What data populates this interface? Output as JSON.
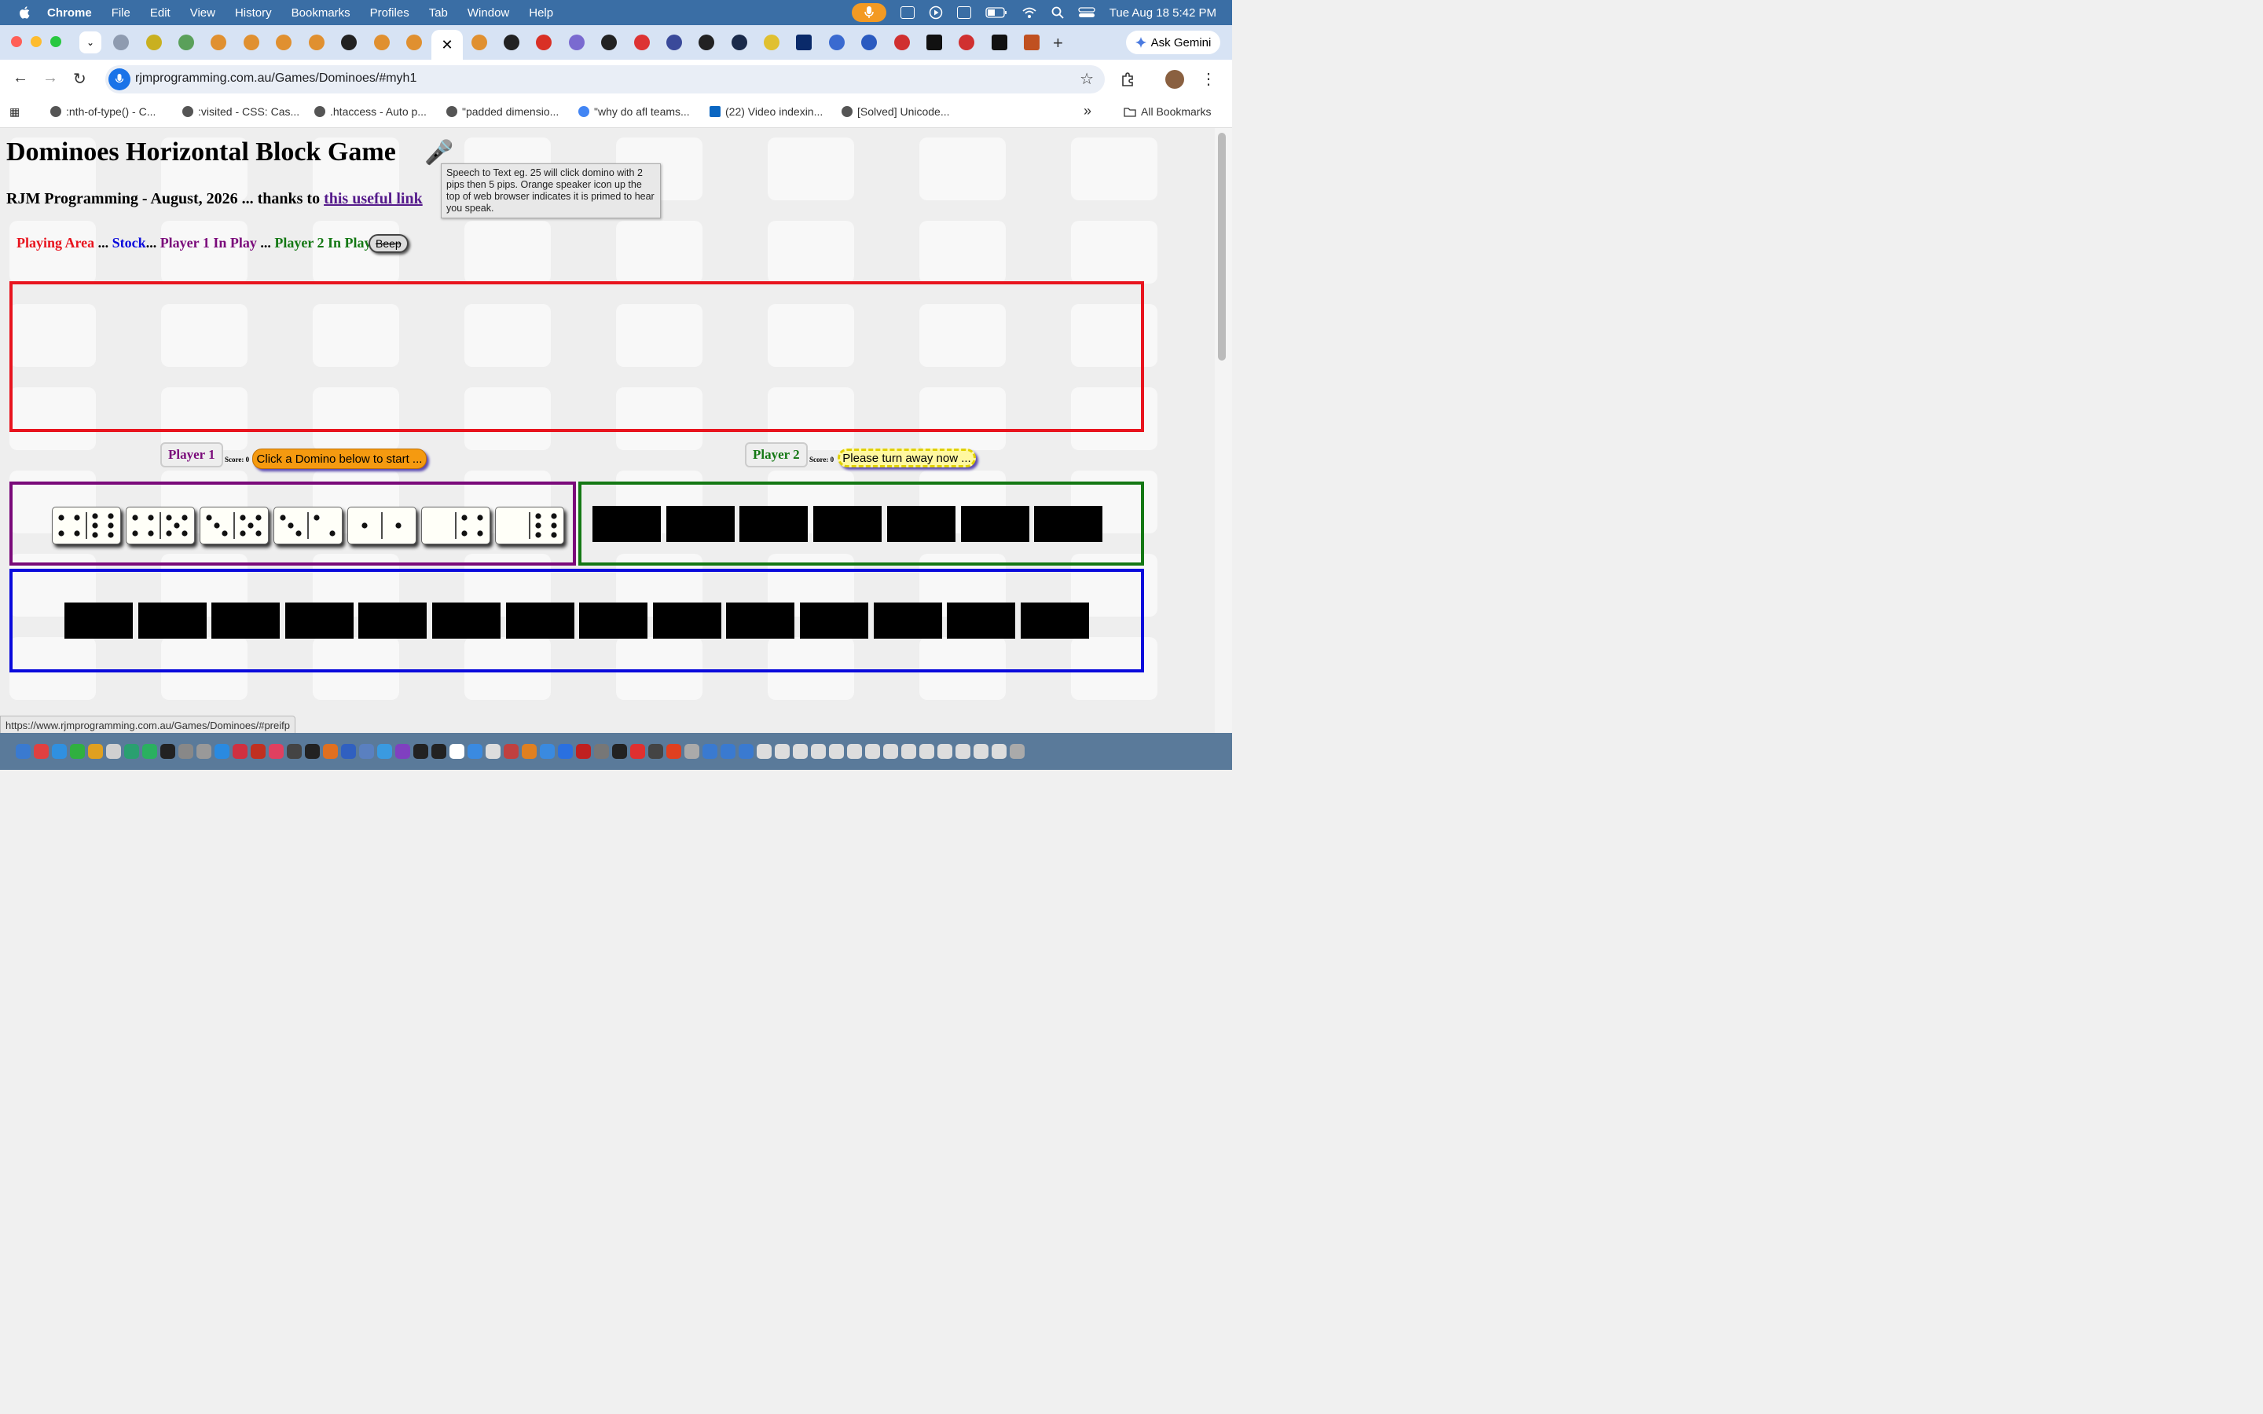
{
  "menubar": {
    "app": "Chrome",
    "items": [
      "File",
      "Edit",
      "View",
      "History",
      "Bookmarks",
      "Profiles",
      "Tab",
      "Window",
      "Help"
    ],
    "clock": "Tue Aug 18  5:42 PM"
  },
  "tabs": {
    "ask_gemini": "Ask Gemini",
    "active_close": "✕",
    "new_tab": "+"
  },
  "toolbar": {
    "url": "rjmprogramming.com.au/Games/Dominoes/#myh1"
  },
  "bookmarks": {
    "items": [
      ":nth-of-type() - C...",
      ":visited - CSS: Cas...",
      ".htaccess - Auto p...",
      "\"padded dimensio...",
      "\"why do afl teams...",
      "(22) Video indexin...",
      "[Solved] Unicode..."
    ],
    "overflow": "»",
    "all_bookmarks": "All Bookmarks"
  },
  "page": {
    "title": "Dominoes Horizontal Block Game",
    "subtitle_prefix": "RJM Programming - August, 2026 ... thanks to ",
    "subtitle_link": "this useful link",
    "tooltip": "Speech to Text eg. 25 will click domino with 2 pips then 5 pips.  Orange speaker icon up the top of web browser indicates it is primed to hear you speak.",
    "legend": {
      "playing_area": "Playing Area",
      "sep1": " ... ",
      "stock": "Stock",
      "sep2": "... ",
      "player1_in_play": "Player 1 In Play",
      "sep3": " ... ",
      "player2_in_play": "Player 2 In Play",
      "beep": "Beep"
    },
    "colors": {
      "playing_area": "#e8141e",
      "stock": "#0a0adc",
      "player1": "#7a0a7a",
      "player2": "#147814"
    },
    "player1": {
      "label": "Player 1",
      "score": "Score: 0",
      "prompt": "Click a Domino below to start ..."
    },
    "player2": {
      "label": "Player 2",
      "score": "Score: 0",
      "prompt": "Please turn away now ..."
    },
    "player1_dominoes": [
      [
        4,
        6
      ],
      [
        4,
        5
      ],
      [
        3,
        5
      ],
      [
        3,
        2
      ],
      [
        1,
        1
      ],
      [
        0,
        4
      ],
      [
        0,
        6
      ]
    ],
    "player2_hidden_count": 7,
    "stock_hidden_count": 14
  },
  "statusbar": "https://www.rjmprogramming.com.au/Games/Dominoes/#preifp"
}
